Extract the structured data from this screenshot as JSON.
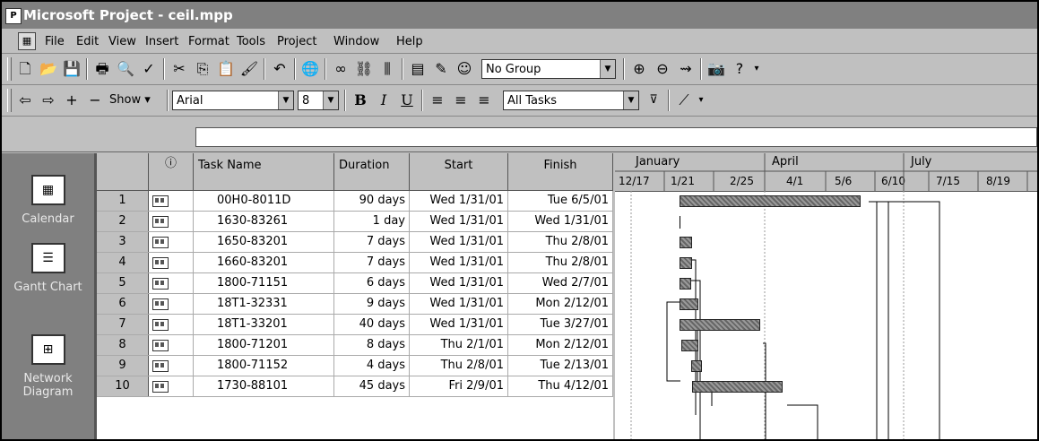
{
  "app": {
    "title": "Microsoft Project - ceil.mpp"
  },
  "menu": [
    "File",
    "Edit",
    "View",
    "Insert",
    "Format",
    "Tools",
    "Project",
    "Window",
    "Help"
  ],
  "toolbar1": {
    "group_select": "No Group"
  },
  "toolbar2": {
    "show_label": "Show",
    "font": "Arial",
    "size": "8",
    "filter": "All Tasks"
  },
  "views": [
    {
      "label": "Calendar",
      "icon": "calendar-icon"
    },
    {
      "label": "Gantt Chart",
      "icon": "gantt-chart-icon"
    },
    {
      "label": "Network Diagram",
      "icon": "network-diagram-icon"
    }
  ],
  "columns": {
    "task_name": "Task Name",
    "duration": "Duration",
    "start": "Start",
    "finish": "Finish"
  },
  "timescale": {
    "months": [
      "January",
      "April",
      "July"
    ],
    "weeks": [
      "12/17",
      "1/21",
      "2/25",
      "4/1",
      "5/6",
      "6/10",
      "7/15",
      "8/19"
    ]
  },
  "tasks": [
    {
      "id": "1",
      "name": "00H0-8011D",
      "duration": "90 days",
      "start": "Wed 1/31/01",
      "finish": "Tue 6/5/01"
    },
    {
      "id": "2",
      "name": "1630-83261",
      "duration": "1 day",
      "start": "Wed 1/31/01",
      "finish": "Wed 1/31/01"
    },
    {
      "id": "3",
      "name": "1650-83201",
      "duration": "7 days",
      "start": "Wed 1/31/01",
      "finish": "Thu 2/8/01"
    },
    {
      "id": "4",
      "name": "1660-83201",
      "duration": "7 days",
      "start": "Wed 1/31/01",
      "finish": "Thu 2/8/01"
    },
    {
      "id": "5",
      "name": "1800-71151",
      "duration": "6 days",
      "start": "Wed 1/31/01",
      "finish": "Wed 2/7/01"
    },
    {
      "id": "6",
      "name": "18T1-32331",
      "duration": "9 days",
      "start": "Wed 1/31/01",
      "finish": "Mon 2/12/01"
    },
    {
      "id": "7",
      "name": "18T1-33201",
      "duration": "40 days",
      "start": "Wed 1/31/01",
      "finish": "Tue 3/27/01"
    },
    {
      "id": "8",
      "name": "1800-71201",
      "duration": "8 days",
      "start": "Thu 2/1/01",
      "finish": "Mon 2/12/01"
    },
    {
      "id": "9",
      "name": "1800-71152",
      "duration": "4 days",
      "start": "Thu 2/8/01",
      "finish": "Tue 2/13/01"
    },
    {
      "id": "10",
      "name": "1730-88101",
      "duration": "45 days",
      "start": "Fri 2/9/01",
      "finish": "Thu 4/12/01"
    }
  ]
}
